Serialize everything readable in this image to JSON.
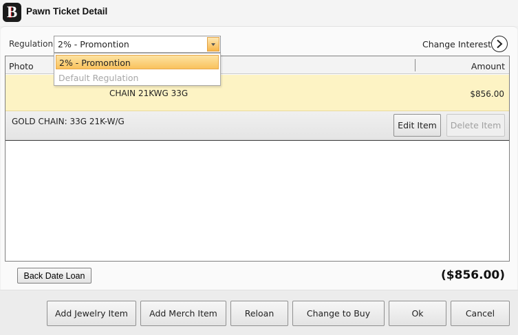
{
  "window": {
    "title": "Pawn Ticket Detail",
    "logo_letter": "B"
  },
  "regulation": {
    "label": "Regulation",
    "selected": "2% - Promontion",
    "options": [
      "2% - Promontion",
      "Default Regulation"
    ]
  },
  "change_interest": {
    "label": "Change Interest"
  },
  "grid": {
    "columns": {
      "photo": "Photo",
      "amount": "Amount"
    },
    "rows": [
      {
        "description": "CHAIN 21KWG 33G",
        "amount": "$856.00",
        "detail": "GOLD CHAIN: 33G 21K-W/G",
        "edit_label": "Edit Item",
        "delete_label": "Delete Item"
      }
    ]
  },
  "back_date_label": "Back Date Loan",
  "total": "($856.00)",
  "footer": {
    "add_jewelry": "Add Jewelry Item",
    "add_merch": "Add Merch Item",
    "reloan": "Reloan",
    "change_to_buy": "Change to Buy",
    "ok": "Ok",
    "cancel": "Cancel"
  },
  "colors": {
    "selected_row": "#fdf3c4",
    "dropdown_highlight": "#f9c25d",
    "logo_background": "#1b1b1b",
    "logo_accent": "#c8161d"
  }
}
